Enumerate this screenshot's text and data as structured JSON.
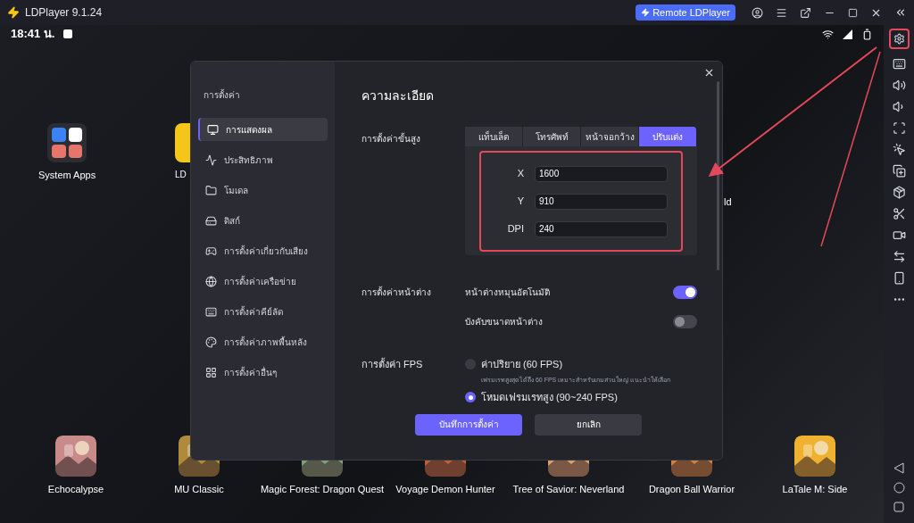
{
  "window": {
    "title": "LDPlayer 9.1.24",
    "remote_button": "Remote LDPlayer"
  },
  "status_bar": {
    "time": "18:41 น."
  },
  "desktop_apps": [
    {
      "label": "System Apps"
    },
    {
      "label": "LD"
    },
    {
      "label": "ld"
    }
  ],
  "dock_apps": [
    {
      "label": "Echocalypse"
    },
    {
      "label": "MU Classic"
    },
    {
      "label": "Magic Forest: Dragon Quest"
    },
    {
      "label": "Voyage Demon Hunter"
    },
    {
      "label": "Tree of Savior: Neverland"
    },
    {
      "label": "Dragon Ball Warrior"
    },
    {
      "label": "LaTale M: Side"
    }
  ],
  "settings": {
    "title": "การตั้งค่า",
    "nav": [
      {
        "label": "การแสดงผล",
        "selected": true
      },
      {
        "label": "ประสิทธิภาพ",
        "selected": false
      },
      {
        "label": "โมเดล",
        "selected": false
      },
      {
        "label": "ดิสก์",
        "selected": false
      },
      {
        "label": "การตั้งค่าเกี่ยวกับเสียง",
        "selected": false
      },
      {
        "label": "การตั้งค่าเครือข่าย",
        "selected": false
      },
      {
        "label": "การตั้งค่าคีย์ลัด",
        "selected": false
      },
      {
        "label": "การตั้งค่าภาพพื้นหลัง",
        "selected": false
      },
      {
        "label": "การตั้งค่าอื่นๆ",
        "selected": false
      }
    ],
    "section_title": "ความละเอียด",
    "advanced": {
      "label": "การตั้งค่าขั้นสูง",
      "tabs": [
        {
          "label": "แท็บเล็ต",
          "selected": false
        },
        {
          "label": "โทรศัพท์",
          "selected": false
        },
        {
          "label": "หน้าจอกว้าง",
          "selected": false
        },
        {
          "label": "ปรับแต่ง",
          "selected": true
        }
      ],
      "fields": [
        {
          "label": "X",
          "value": "1600"
        },
        {
          "label": "Y",
          "value": "910"
        },
        {
          "label": "DPI",
          "value": "240"
        }
      ]
    },
    "window_settings": {
      "label": "การตั้งค่าหน้าต่าง",
      "toggles": [
        {
          "label": "หน้าต่างหมุนอัตโนมัติ",
          "on": true
        },
        {
          "label": "บังคับขนาดหน้าต่าง",
          "on": false
        }
      ]
    },
    "fps": {
      "label": "การตั้งค่า FPS",
      "options": [
        {
          "label": "ค่าปริยาย (60 FPS)",
          "hint": "เฟรมเรทสูงสุดได้ถึง 60 FPS เหมาะสำหรับเกมส่วนใหญ่ แนะนำให้เลือก",
          "selected": false
        },
        {
          "label": "โหมดเฟรมเรทสูง (90~240 FPS)",
          "selected": true
        }
      ]
    },
    "buttons": {
      "save": "บันทึกการตั้งค่า",
      "cancel": "ยกเลิก"
    }
  }
}
